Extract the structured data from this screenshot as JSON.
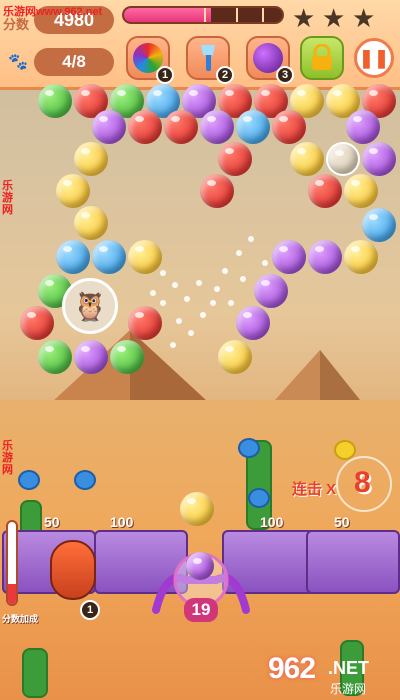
{
  "watermark": {
    "top": "乐游网www.962.net",
    "side_upper": "乐游网",
    "side_lower": "乐游网",
    "bottom_num": "962",
    "bottom_net": ".NET",
    "bottom_cn": "乐游网"
  },
  "hud": {
    "score_label": "分数",
    "score": "4980",
    "moves": "4/8",
    "progress_fraction": 0.55,
    "stars_earned": 0,
    "stars_total": 3,
    "boosters": [
      {
        "name": "rainbow-ball",
        "count": "1"
      },
      {
        "name": "paint-brush",
        "count": "2"
      },
      {
        "name": "bomb-ball",
        "count": "3"
      },
      {
        "name": "lock",
        "count": ""
      }
    ],
    "pause_icon": "pause-icon"
  },
  "combo": {
    "label": "连击 X",
    "value": "8"
  },
  "bins": [
    {
      "label": "50"
    },
    {
      "label": "100"
    },
    {
      "label": "100"
    },
    {
      "label": "50"
    }
  ],
  "shooter": {
    "shots_left": "19",
    "loaded_color": "purple",
    "next_color": "yellow"
  },
  "power": {
    "label": "分数加成",
    "fraction": 0.25
  },
  "hero": {
    "badge": "1"
  },
  "colors": {
    "red": "#d81f1f",
    "green": "#2ea52c",
    "blue": "#1e8ee0",
    "purple": "#8a32c8",
    "yellow": "#f5b10f",
    "hud_brown": "#c46c42",
    "progress_pink": "#e8357a"
  }
}
